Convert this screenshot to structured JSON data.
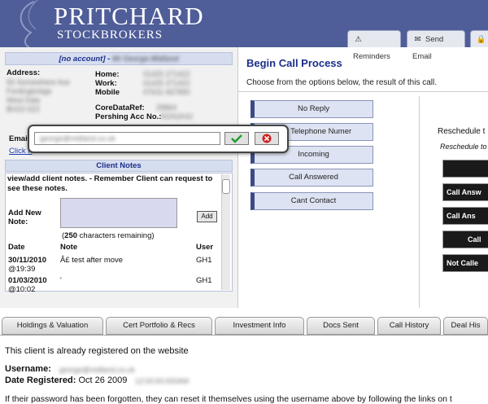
{
  "header": {
    "logo_main": "PRITCHARD",
    "logo_sub": "STOCKBROKERS",
    "buttons": [
      {
        "label": "Reminders",
        "icon": "warning-icon"
      },
      {
        "label": "Send Email",
        "icon": "envelope-icon"
      }
    ]
  },
  "client": {
    "account_label": "[no account] -",
    "address_label": "Address:",
    "home_label": "Home:",
    "work_label": "Work:",
    "mobile_label": "Mobile",
    "coredata_label": "CoreDataRef:",
    "pershing_label": "Pershing Acc No.:",
    "email_label": "Email",
    "click_link": "Click h"
  },
  "notes": {
    "header": "Client Notes",
    "intro": "view/add client notes. - Remember Client can request to see these notes.",
    "add_label": "Add New Note:",
    "add_button": "Add",
    "remaining_count": "250",
    "remaining_text": " characters remaining)",
    "columns": [
      "Date",
      "Note",
      "User"
    ],
    "rows": [
      {
        "date": "30/11/2010",
        "time": "@19:39",
        "note": "Â£ test after move",
        "user": "GH1"
      },
      {
        "date": "01/03/2010",
        "time": "@10:02",
        "note": "'",
        "user": "GH1"
      }
    ]
  },
  "call": {
    "title": "Begin Call Process",
    "subtitle": "Choose from the options below, the result of this call.",
    "options": [
      "No Reply",
      "rect Telephone Numer",
      "Incoming",
      "Call Answered",
      "Cant Contact"
    ],
    "reschedule_label": "Reschedule t",
    "reschedule_sub": "Reschedule to",
    "dark_buttons": [
      "",
      "Call Answ",
      "Call Ans",
      "Call",
      "Not Calle"
    ]
  },
  "tabs": [
    "Holdings & Valuation",
    "Cert Portfolio & Recs",
    "Investment Info",
    "Docs Sent",
    "Call History",
    "Deal His"
  ],
  "website": {
    "registered_text": "This client is already registered on the website",
    "username_label": "Username:",
    "date_label": "Date Registered:",
    "date_value": "Oct 26 2009",
    "forgot_text": "If their password has been forgotten, they can reset it themselves using the username above by following the links on t"
  }
}
